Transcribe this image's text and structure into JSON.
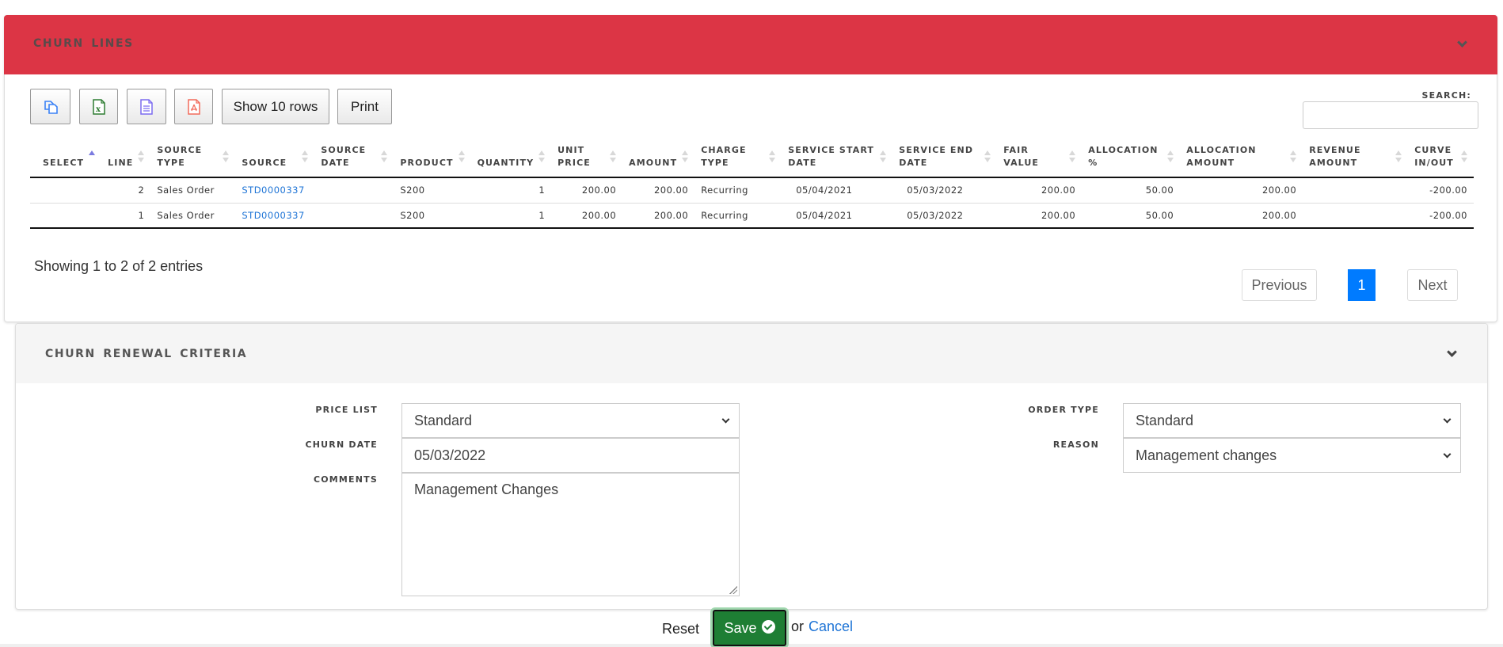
{
  "churn_lines": {
    "title": "CHURN LINES",
    "toolbar": {
      "copy_icon": "copy-icon",
      "excel_icon": "excel-icon",
      "csv_icon": "csv-icon",
      "pdf_icon": "pdf-icon",
      "show_rows_label": "Show 10 rows",
      "print_label": "Print"
    },
    "search": {
      "label": "SEARCH:",
      "value": "",
      "placeholder": ""
    },
    "columns": [
      [
        "SELECT",
        ""
      ],
      [
        "LINE",
        ""
      ],
      [
        "SOURCE",
        "TYPE"
      ],
      [
        "SOURCE",
        ""
      ],
      [
        "SOURCE",
        "DATE"
      ],
      [
        "PRODUCT",
        ""
      ],
      [
        "QUANTITY",
        ""
      ],
      [
        "UNIT",
        "PRICE"
      ],
      [
        "AMOUNT",
        ""
      ],
      [
        "CHARGE",
        "TYPE"
      ],
      [
        "SERVICE START",
        "DATE"
      ],
      [
        "SERVICE END",
        "DATE"
      ],
      [
        "FAIR",
        "VALUE"
      ],
      [
        "ALLOCATION",
        "%"
      ],
      [
        "ALLOCATION",
        "AMOUNT"
      ],
      [
        "REVENUE",
        "AMOUNT"
      ],
      [
        "CURVE",
        "IN/OUT"
      ]
    ],
    "sorted_column": "SELECT",
    "sort_direction": "asc",
    "rows": [
      {
        "select": "",
        "line": "2",
        "source_type": "Sales Order",
        "source": "STD0000337",
        "source_date": "",
        "product": "S200",
        "quantity": "1",
        "unit_price": "200.00",
        "amount": "200.00",
        "charge_type": "Recurring",
        "service_start_date": "05/04/2021",
        "service_end_date": "05/03/2022",
        "fair_value": "200.00",
        "allocation_pct": "50.00",
        "allocation_amount": "200.00",
        "revenue_amount": "",
        "curve_in_out": "-200.00"
      },
      {
        "select": "",
        "line": "1",
        "source_type": "Sales Order",
        "source": "STD0000337",
        "source_date": "",
        "product": "S200",
        "quantity": "1",
        "unit_price": "200.00",
        "amount": "200.00",
        "charge_type": "Recurring",
        "service_start_date": "05/04/2021",
        "service_end_date": "05/03/2022",
        "fair_value": "200.00",
        "allocation_pct": "50.00",
        "allocation_amount": "200.00",
        "revenue_amount": "",
        "curve_in_out": "-200.00"
      }
    ],
    "info": "Showing 1 to 2 of 2 entries",
    "pagination": {
      "previous": "Previous",
      "current_page": "1",
      "next": "Next"
    }
  },
  "renewal_criteria": {
    "title": "CHURN RENEWAL CRITERIA",
    "price_list": {
      "label": "PRICE LIST",
      "value": "Standard"
    },
    "churn_date": {
      "label": "CHURN DATE",
      "value": "05/03/2022"
    },
    "comments": {
      "label": "COMMENTS",
      "value": "Management Changes"
    },
    "order_type": {
      "label": "ORDER TYPE",
      "value": "Standard"
    },
    "reason": {
      "label": "REASON",
      "value": "Management changes"
    }
  },
  "actions": {
    "reset_label": "Reset",
    "save_label": "Save",
    "or_label": "or",
    "cancel_label": "Cancel"
  },
  "colors": {
    "header_red": "#dc3545",
    "save_green": "#1e7e34",
    "link_blue": "#1e74d6",
    "page_active": "#007bff"
  }
}
